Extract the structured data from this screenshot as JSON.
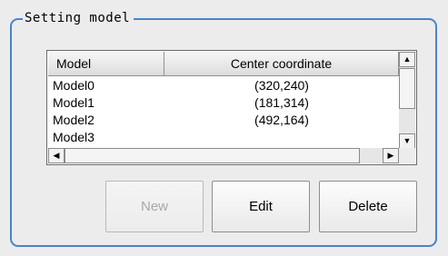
{
  "group": {
    "title": "Setting model"
  },
  "list": {
    "columns": [
      "Model",
      "Center coordinate"
    ],
    "rows": [
      {
        "model": "Model0",
        "center": "(320,240)"
      },
      {
        "model": "Model1",
        "center": "(181,314)"
      },
      {
        "model": "Model2",
        "center": "(492,164)"
      },
      {
        "model": "Model3",
        "center": ""
      }
    ]
  },
  "buttons": {
    "new_label": "New",
    "edit_label": "Edit",
    "delete_label": "Delete"
  }
}
